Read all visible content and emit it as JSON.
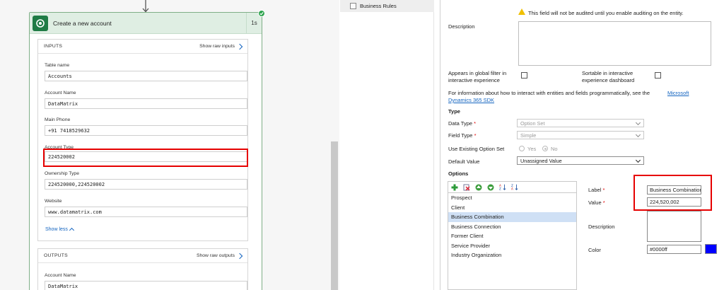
{
  "flow": {
    "card": {
      "title": "Create a new account",
      "duration": "1s"
    },
    "inputs": {
      "title": "INPUTS",
      "raw_link": "Show raw inputs",
      "fields": [
        {
          "label": "Table name",
          "value": "Accounts"
        },
        {
          "label": "Account Name",
          "value": "DataMatrix"
        },
        {
          "label": "Main Phone",
          "value": "+91 7418529632"
        },
        {
          "label": "Account Type",
          "value": "224520002"
        },
        {
          "label": "Ownership Type",
          "value": "224520000,224520002"
        },
        {
          "label": "Website",
          "value": "www.datamatrix.com"
        }
      ],
      "show_less": "Show less"
    },
    "outputs": {
      "title": "OUTPUTS",
      "raw_link": "Show raw outputs",
      "fields": [
        {
          "label": "Account Name",
          "value": "DataMatrix"
        }
      ]
    }
  },
  "nav": {
    "business_rules": "Business Rules"
  },
  "field_editor": {
    "audit_warning": "This field will not be audited until you enable auditing on the entity.",
    "description_label": "Description",
    "global_filter_label_1": "Appears in global filter in",
    "global_filter_label_2": "interactive experience",
    "sortable_label_1": "Sortable in interactive",
    "sortable_label_2": "experience dashboard",
    "sdk_text": "For information about how to interact with entities and fields programmatically, see the",
    "sdk_link_1": "Microsoft",
    "sdk_link_2": "Dynamics 365 SDK",
    "type_heading": "Type",
    "data_type_label": "Data Type",
    "data_type_value": "Option Set",
    "field_type_label": "Field Type",
    "field_type_value": "Simple",
    "use_existing_label": "Use Existing Option Set",
    "yes_label": "Yes",
    "no_label": "No",
    "default_value_label": "Default Value",
    "default_value": "Unassigned Value",
    "options_heading": "Options",
    "options": [
      "Prospect",
      "Client",
      "Business Combination",
      "Business Connection",
      "Former Client",
      "Service Provider",
      "Industry Organization"
    ],
    "selected_option": "Business Combination",
    "label_label": "Label",
    "label_value": "Business Combination",
    "value_label": "Value",
    "value_value": "224,520,002",
    "option_description_label": "Description",
    "color_label": "Color",
    "color_value": "#0000ff",
    "required_marker": "*"
  },
  "colors": {
    "flow_header": "#dfeee3",
    "success": "#2ea44f",
    "link": "#1565c0",
    "highlight_red": "#e60000",
    "selected_row": "#cfe0f5",
    "option_color": "#0000ff"
  }
}
